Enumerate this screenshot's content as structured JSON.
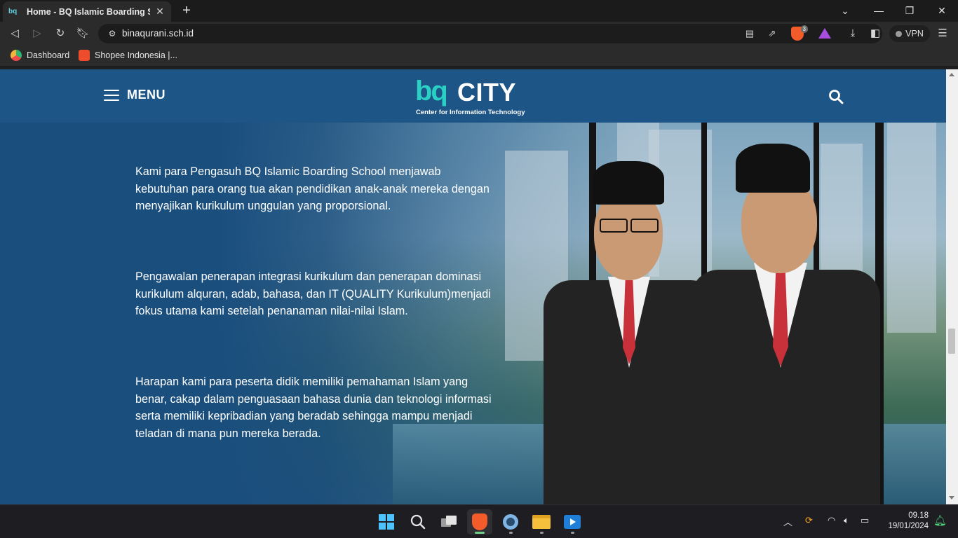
{
  "browser": {
    "tab": {
      "favicon_text": "bq",
      "title": "Home - BQ Islamic Boarding Sch"
    },
    "url": "binaqurani.sch.id",
    "shield_count": "3",
    "vpn_label": "VPN",
    "bookmarks": [
      {
        "label": "Dashboard"
      },
      {
        "label": "Shopee Indonesia |..."
      }
    ]
  },
  "site": {
    "menu_label": "MENU",
    "logo": {
      "bq": "bq",
      "city": "CITY",
      "subtitle": "Center for Information Technology"
    },
    "paragraphs": [
      "Kami para Pengasuh BQ Islamic Boarding School menjawab kebutuhan para orang tua akan pendidikan anak-anak mereka dengan menyajikan kurikulum unggulan yang proporsional.",
      "Pengawalan penerapan integrasi kurikulum dan penerapan dominasi kurikulum alquran, adab, bahasa, dan IT (QUALITY Kurikulum)menjadi fokus utama kami setelah penanaman nilai-nilai Islam.",
      "Harapan kami para peserta didik memiliki pemahaman Islam yang benar, cakap dalam penguasaan bahasa dunia dan teknologi informasi serta memiliki kepribadian yang beradab sehingga mampu menjadi teladan di mana pun mereka berada."
    ]
  },
  "taskbar": {
    "time": "09.18",
    "date": "19/01/2024"
  },
  "colors": {
    "page_bg": "#1a4f7e",
    "header_bg": "#1c5586",
    "logo_accent": "#2bd0c4",
    "tie_red": "#c8303a"
  }
}
